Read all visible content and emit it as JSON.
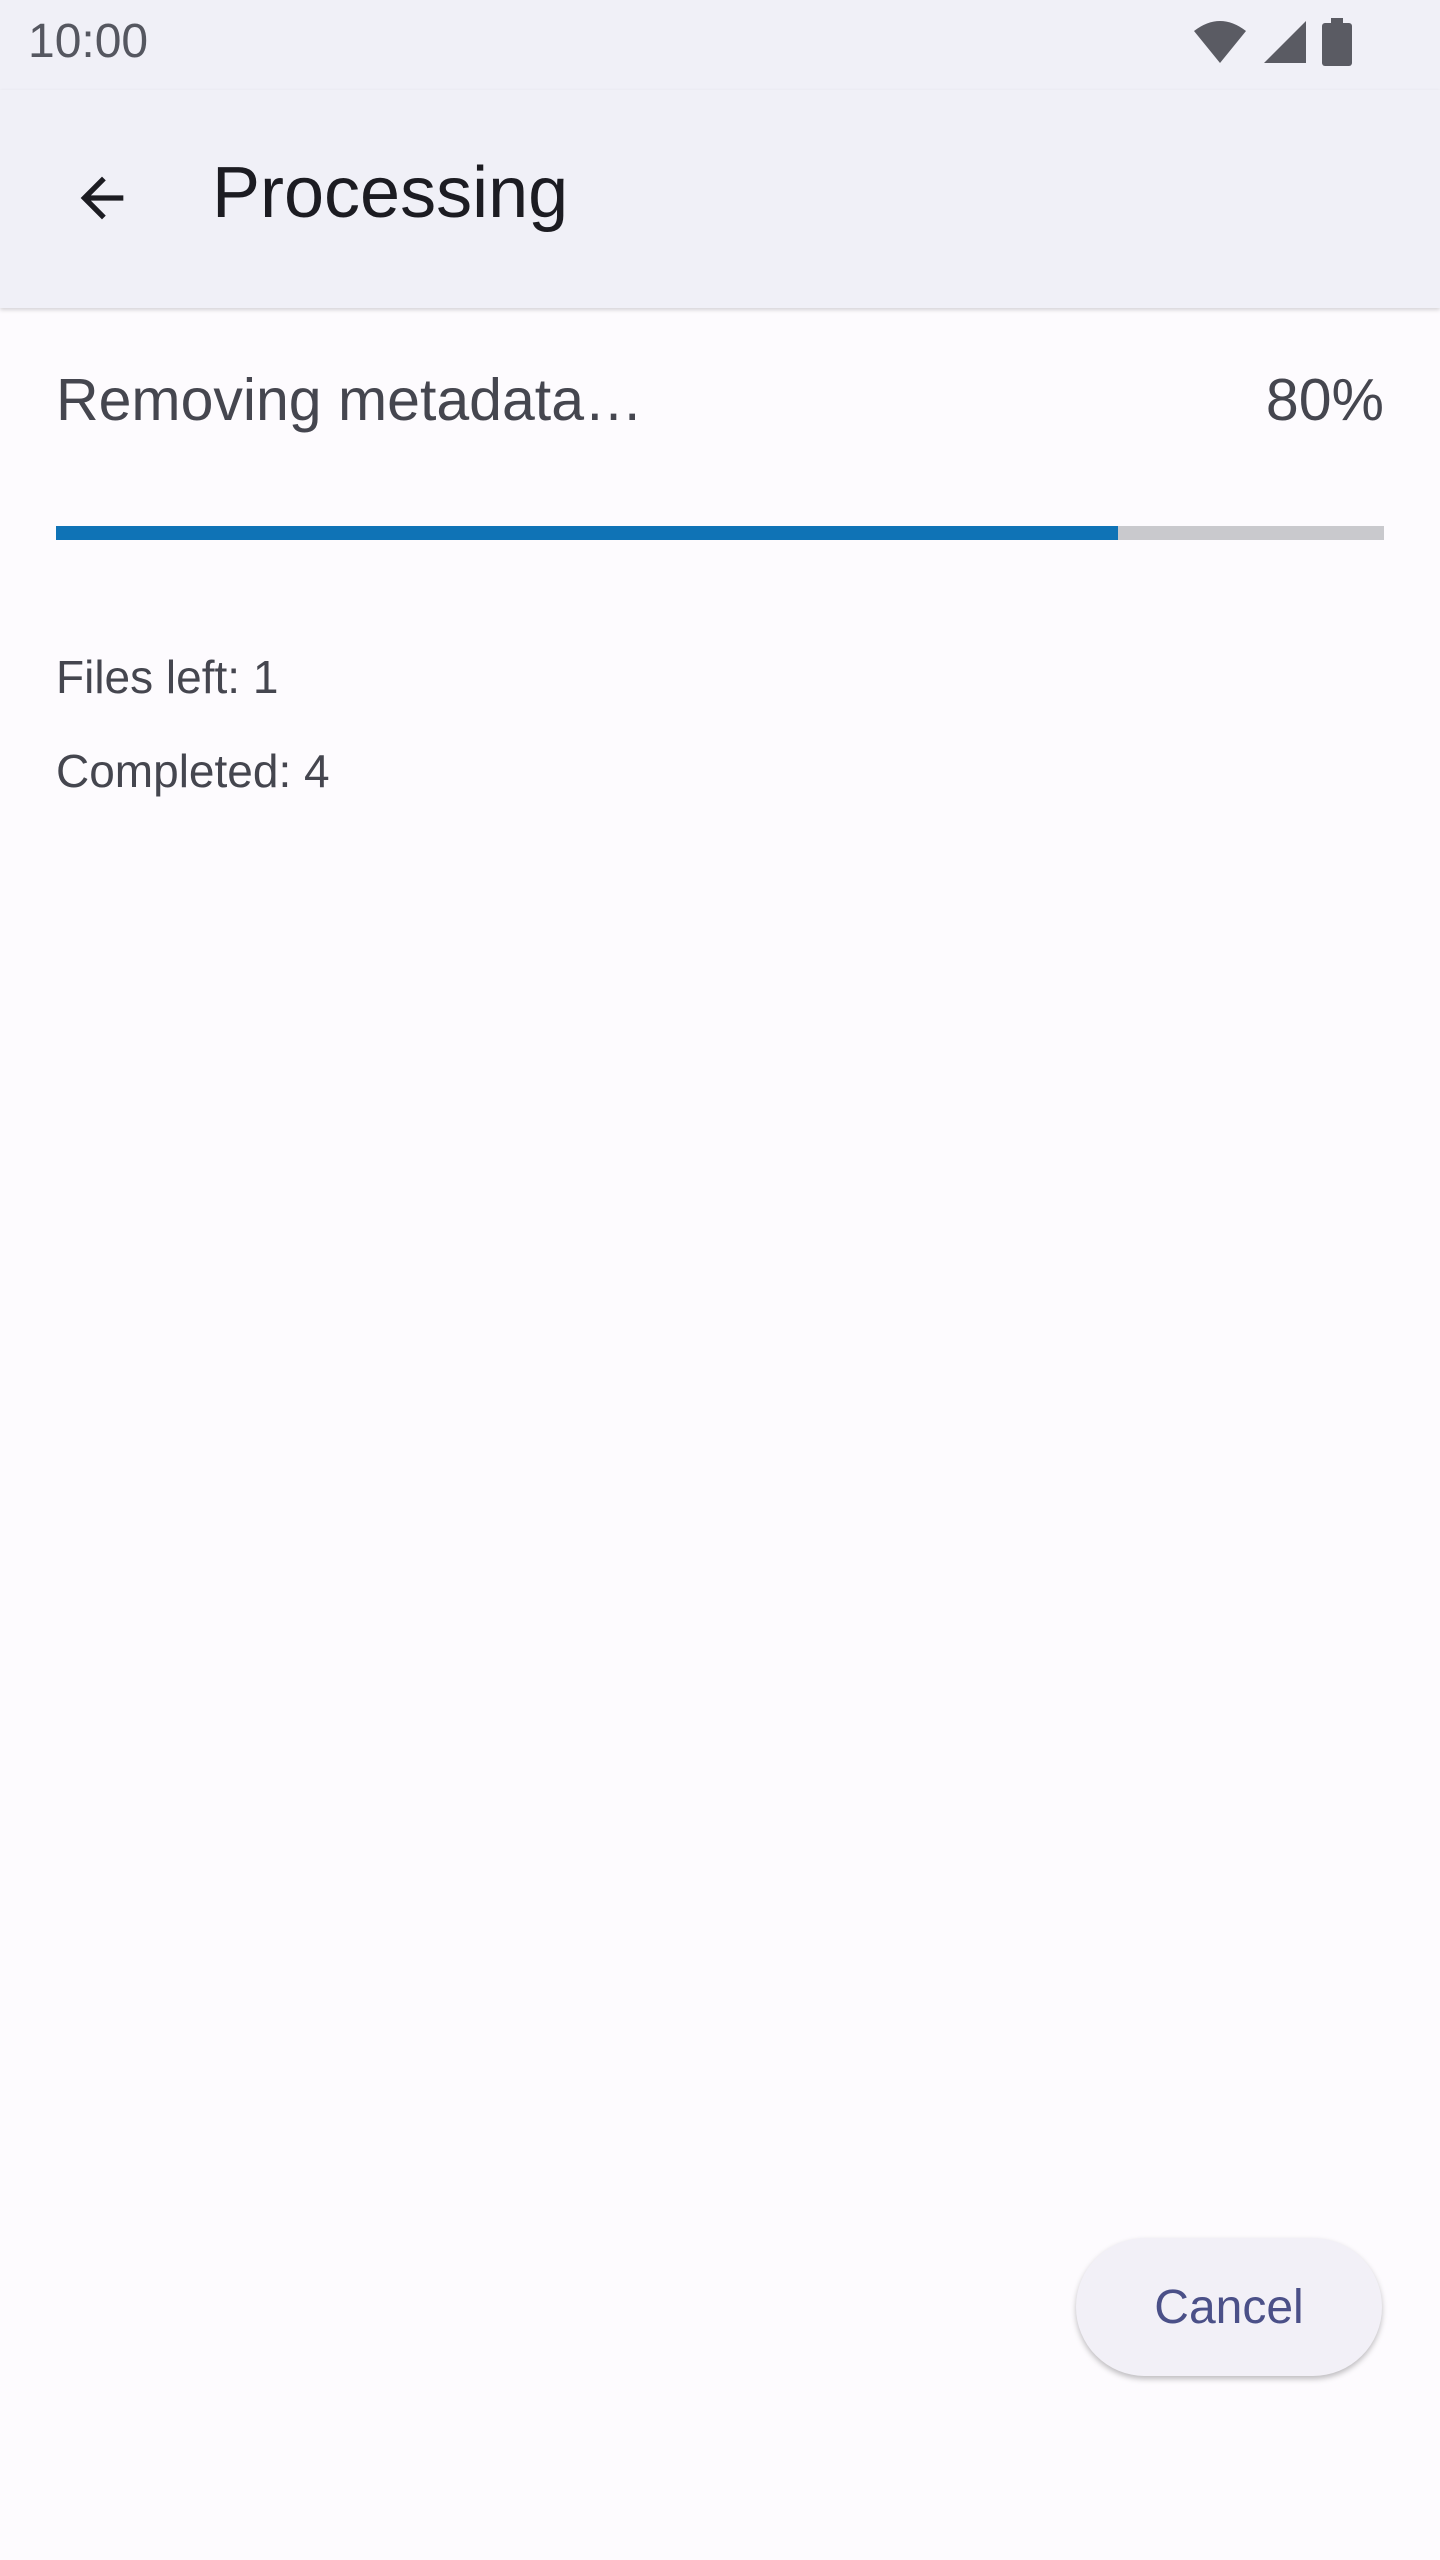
{
  "status_bar": {
    "time": "10:00",
    "icons": [
      "wifi-icon",
      "signal-icon",
      "battery-icon"
    ]
  },
  "app_bar": {
    "back_icon": "arrow-back-icon",
    "title": "Processing"
  },
  "task": {
    "label": "Removing metadata…",
    "percent_text": "80%",
    "progress_fraction": 0.8
  },
  "stats": {
    "files_left": "Files left: 1",
    "completed": "Completed: 4"
  },
  "actions": {
    "cancel_label": "Cancel"
  },
  "colors": {
    "progress_fill": "#0f73b6",
    "progress_track": "#c9c9cd",
    "cancel_text": "#4b5088",
    "app_bar_bg": "#f0f0f7"
  }
}
